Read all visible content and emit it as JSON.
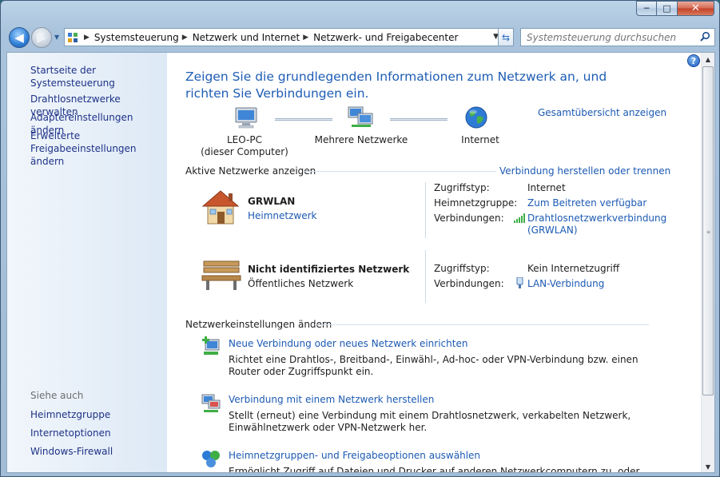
{
  "window": {
    "caption_min": "─",
    "caption_max": "□",
    "caption_close": "✕"
  },
  "address": {
    "segments": [
      "Systemsteuerung",
      "Netzwerk und Internet",
      "Netzwerk- und Freigabecenter"
    ],
    "search_placeholder": "Systemsteuerung durchsuchen"
  },
  "sidebar": {
    "home": "Startseite der Systemsteuerung",
    "links": [
      "Drahtlosnetzwerke verwalten",
      "Adaptereinstellungen ändern",
      "Erweiterte Freigabeeinstellungen ändern"
    ],
    "see_also_heading": "Siehe auch",
    "see_also": [
      "Heimnetzgruppe",
      "Internetoptionen",
      "Windows-Firewall"
    ]
  },
  "main": {
    "title": "Zeigen Sie die grundlegenden Informationen zum Netzwerk an, und richten Sie Verbindungen ein.",
    "full_map_link": "Gesamtübersicht anzeigen",
    "map": {
      "computer_name": "LEO-PC",
      "computer_sub": "(dieser Computer)",
      "middle": "Mehrere Netzwerke",
      "internet": "Internet"
    },
    "active_networks": {
      "heading": "Aktive Netzwerke anzeigen",
      "action_link": "Verbindung herstellen oder trennen",
      "networks": [
        {
          "name": "GRWLAN",
          "type": "Heimnetzwerk",
          "access_label": "Zugriffstyp:",
          "access_value": "Internet",
          "homegroup_label": "Heimnetzgruppe:",
          "homegroup_value": "Zum Beitreten verfügbar",
          "conn_label": "Verbindungen:",
          "conn_value_1": "Drahtlosnetzwerkverbindung",
          "conn_value_2": "(GRWLAN)"
        },
        {
          "name": "Nicht identifiziertes Netzwerk",
          "type": "Öffentliches Netzwerk",
          "access_label": "Zugriffstyp:",
          "access_value": "Kein Internetzugriff",
          "conn_label": "Verbindungen:",
          "conn_value": "LAN-Verbindung"
        }
      ]
    },
    "change_settings": {
      "heading": "Netzwerkeinstellungen ändern",
      "tasks": [
        {
          "link": "Neue Verbindung oder neues Netzwerk einrichten",
          "desc": "Richtet eine Drahtlos-, Breitband-, Einwähl-, Ad-hoc- oder VPN-Verbindung bzw. einen Router oder Zugriffspunkt ein."
        },
        {
          "link": "Verbindung mit einem Netzwerk herstellen",
          "desc": "Stellt (erneut) eine Verbindung mit einem Drahtlosnetzwerk, verkabelten Netzwerk, Einwählnetzwerk oder VPN-Netzwerk her."
        },
        {
          "link": "Heimnetzgruppen- und Freigabeoptionen auswählen",
          "desc": "Ermöglicht Zugriff auf Dateien und Drucker auf anderen Netzwerkcomputern zu, oder ändert die"
        }
      ]
    }
  },
  "colors": {
    "link": "#1c5ab3",
    "title": "#1e5db5",
    "sidebar_link": "#1e3287"
  }
}
